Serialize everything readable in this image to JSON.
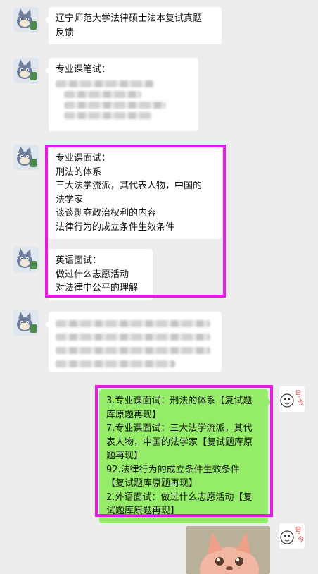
{
  "colors": {
    "background": "#ededed",
    "incoming_bubble": "#ffffff",
    "outgoing_bubble": "#95ec69",
    "highlight_border": "#e619e6"
  },
  "messages": [
    {
      "side": "left",
      "lines": [
        "辽宁师范大学法律硕士法本复试真题",
        "反馈"
      ]
    },
    {
      "side": "left",
      "lines": [
        "专业课笔试："
      ],
      "blurred_lines": 4
    },
    {
      "side": "left",
      "lines": [
        "专业课面试：",
        "刑法的体系",
        "三大法学流派，其代表人物，中国的",
        "法学家",
        "谈谈剥夺政治权利的内容",
        "法律行为的成立条件生效条件"
      ]
    },
    {
      "side": "left",
      "lines": [
        "英语面试：",
        "做过什么志愿活动",
        "对法律中公平的理解"
      ]
    },
    {
      "side": "left",
      "lines": [],
      "blurred_lines": 4
    },
    {
      "side": "right",
      "lines": [
        "3.专业课面试：刑法的体系【复试题",
        "库原题再现】",
        "7.专业课面试：三大法学流派，其代",
        "表人物，中国的法学家【复试题库原",
        "题再现】",
        "92.法律行为的成立条件生效条件",
        "【复试题库原题再现】",
        "2.外语面试：做过什么志愿活动【复",
        "试题库原题再现】"
      ]
    },
    {
      "side": "right",
      "sticker": "pink-fox-sticker"
    }
  ],
  "icons": {
    "contact_avatar": "cartoon-cat-avatar-icon",
    "self_avatar": "sketch-avatar-icon"
  }
}
